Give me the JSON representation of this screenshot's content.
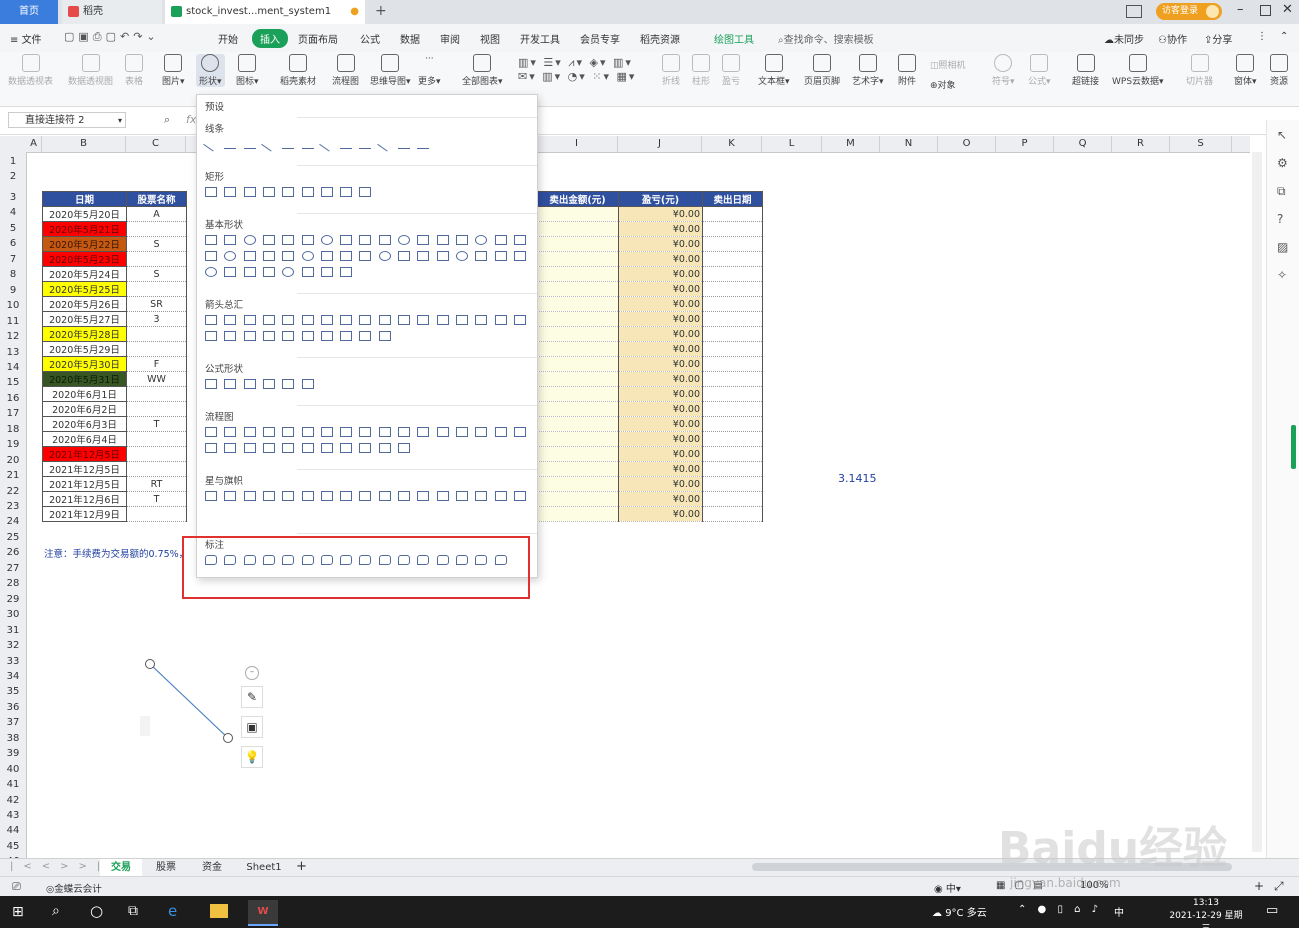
{
  "tabs": [
    {
      "label": "首页"
    },
    {
      "label": "稻壳"
    },
    {
      "label": "stock_invest...ment_system1"
    }
  ],
  "window": {
    "visitor_login": "访客登录"
  },
  "menus": [
    "文件",
    "开始",
    "插入",
    "页面布局",
    "公式",
    "数据",
    "审阅",
    "视图",
    "开发工具",
    "会员专享",
    "稻壳资源",
    "绘图工具"
  ],
  "search_placeholder": "查找命令、搜索模板",
  "sync": {
    "unsync": "未同步",
    "collab": "协作",
    "share": "分享"
  },
  "ribbon": [
    {
      "label": "数据透视表",
      "dim": true
    },
    {
      "label": "数据透视图",
      "dim": true
    },
    {
      "label": "表格",
      "dim": true
    },
    {
      "label": "图片"
    },
    {
      "label": "形状"
    },
    {
      "label": "图标"
    },
    {
      "label": "稻壳素材"
    },
    {
      "label": "流程图"
    },
    {
      "label": "思维导图"
    },
    {
      "label": "更多"
    },
    {
      "label": "全部图表"
    },
    {
      "label": "折线",
      "dim": true
    },
    {
      "label": "柱形",
      "dim": true
    },
    {
      "label": "盈亏",
      "dim": true
    },
    {
      "label": "文本框"
    },
    {
      "label": "页眉页脚"
    },
    {
      "label": "艺术字"
    },
    {
      "label": "附件"
    },
    {
      "label": "对象"
    },
    {
      "label": "符号",
      "dim": true
    },
    {
      "label": "公式",
      "dim": true
    },
    {
      "label": "超链接"
    },
    {
      "label": "WPS云数据"
    },
    {
      "label": "切片器",
      "dim": true
    },
    {
      "label": "窗体"
    },
    {
      "label": "资源"
    }
  ],
  "ribbon_extra": {
    "camera": "照相机"
  },
  "name_box": "直接连接符 2",
  "columns": [
    "A",
    "B",
    "C",
    "I",
    "J",
    "K",
    "L",
    "M",
    "N",
    "O",
    "P",
    "Q",
    "R",
    "S"
  ],
  "rows": [
    "1",
    "2",
    "3",
    "4",
    "5",
    "6",
    "7",
    "8",
    "9",
    "10",
    "11",
    "12",
    "13",
    "14",
    "15",
    "16",
    "17",
    "18",
    "19",
    "20",
    "21",
    "22",
    "23",
    "24",
    "25",
    "26",
    "27",
    "28",
    "29",
    "30",
    "31",
    "32",
    "33",
    "34",
    "35",
    "36",
    "37",
    "38",
    "39",
    "40",
    "41",
    "42",
    "43",
    "44",
    "45",
    "46"
  ],
  "table": {
    "headers": [
      "日期",
      "股票名称",
      "卖出金额(元)",
      "盈亏(元)",
      "卖出日期"
    ],
    "rows": [
      {
        "date": "2020年5月20日",
        "name": "A",
        "color": "",
        "profit": "¥0.00"
      },
      {
        "date": "2020年5月21日",
        "name": "",
        "color": "red",
        "profit": "¥0.00"
      },
      {
        "date": "2020年5月22日",
        "name": "S",
        "color": "orange",
        "profit": "¥0.00"
      },
      {
        "date": "2020年5月23日",
        "name": "",
        "color": "red",
        "profit": "¥0.00"
      },
      {
        "date": "2020年5月24日",
        "name": "S",
        "color": "",
        "profit": "¥0.00"
      },
      {
        "date": "2020年5月25日",
        "name": "",
        "color": "yellow",
        "profit": "¥0.00"
      },
      {
        "date": "2020年5月26日",
        "name": "SR",
        "color": "",
        "profit": "¥0.00"
      },
      {
        "date": "2020年5月27日",
        "name": "3",
        "color": "",
        "profit": "¥0.00"
      },
      {
        "date": "2020年5月28日",
        "name": "",
        "color": "yellow",
        "profit": "¥0.00"
      },
      {
        "date": "2020年5月29日",
        "name": "",
        "color": "",
        "profit": "¥0.00"
      },
      {
        "date": "2020年5月30日",
        "name": "F",
        "color": "yellow",
        "profit": "¥0.00"
      },
      {
        "date": "2020年5月31日",
        "name": "WW",
        "color": "dark",
        "profit": "¥0.00"
      },
      {
        "date": "2020年6月1日",
        "name": "",
        "color": "",
        "profit": "¥0.00"
      },
      {
        "date": "2020年6月2日",
        "name": "",
        "color": "",
        "profit": "¥0.00"
      },
      {
        "date": "2020年6月3日",
        "name": "T",
        "color": "",
        "profit": "¥0.00"
      },
      {
        "date": "2020年6月4日",
        "name": "",
        "color": "",
        "profit": "¥0.00"
      },
      {
        "date": "2021年12月5日",
        "name": "",
        "color": "red",
        "profit": "¥0.00"
      },
      {
        "date": "2021年12月5日",
        "name": "",
        "color": "",
        "profit": "¥0.00"
      },
      {
        "date": "2021年12月5日",
        "name": "RT",
        "color": "",
        "profit": "¥0.00"
      },
      {
        "date": "2021年12月6日",
        "name": "T",
        "color": "",
        "profit": "¥0.00"
      },
      {
        "date": "2021年12月9日",
        "name": "",
        "color": "",
        "profit": "¥0.00"
      }
    ]
  },
  "note": "注意：手续费为交易额的0.75%，",
  "pi_value": "3.1415",
  "shapes_menu": {
    "preset": "预设",
    "sections": [
      {
        "title": "线条",
        "count": 12,
        "rows": 1
      },
      {
        "title": "矩形",
        "count": 9,
        "rows": 1
      },
      {
        "title": "基本形状",
        "count": 42,
        "rows": 3
      },
      {
        "title": "箭头总汇",
        "count": 27,
        "rows": 2
      },
      {
        "title": "公式形状",
        "count": 6,
        "rows": 1
      },
      {
        "title": "流程图",
        "count": 28,
        "rows": 2
      },
      {
        "title": "星与旗帜",
        "count": 17,
        "rows": 2
      },
      {
        "title": "标注",
        "count": 16,
        "rows": 1
      }
    ]
  },
  "sheets": [
    "交易",
    "股票",
    "资金",
    "Sheet1"
  ],
  "status": {
    "app": "金蝶云会计",
    "zoom": "100%"
  },
  "taskbar": {
    "weather": "9°C 多云",
    "time": "13:13",
    "date": "2021-12-29 星期三",
    "lang": "中"
  },
  "watermark": "Baidu经验",
  "watermark_url": "jingyan.baidu.com",
  "colors": {
    "header_blue": "#2f4f9f",
    "accent_green": "#1aa058",
    "highlight_red": "#e03030"
  }
}
